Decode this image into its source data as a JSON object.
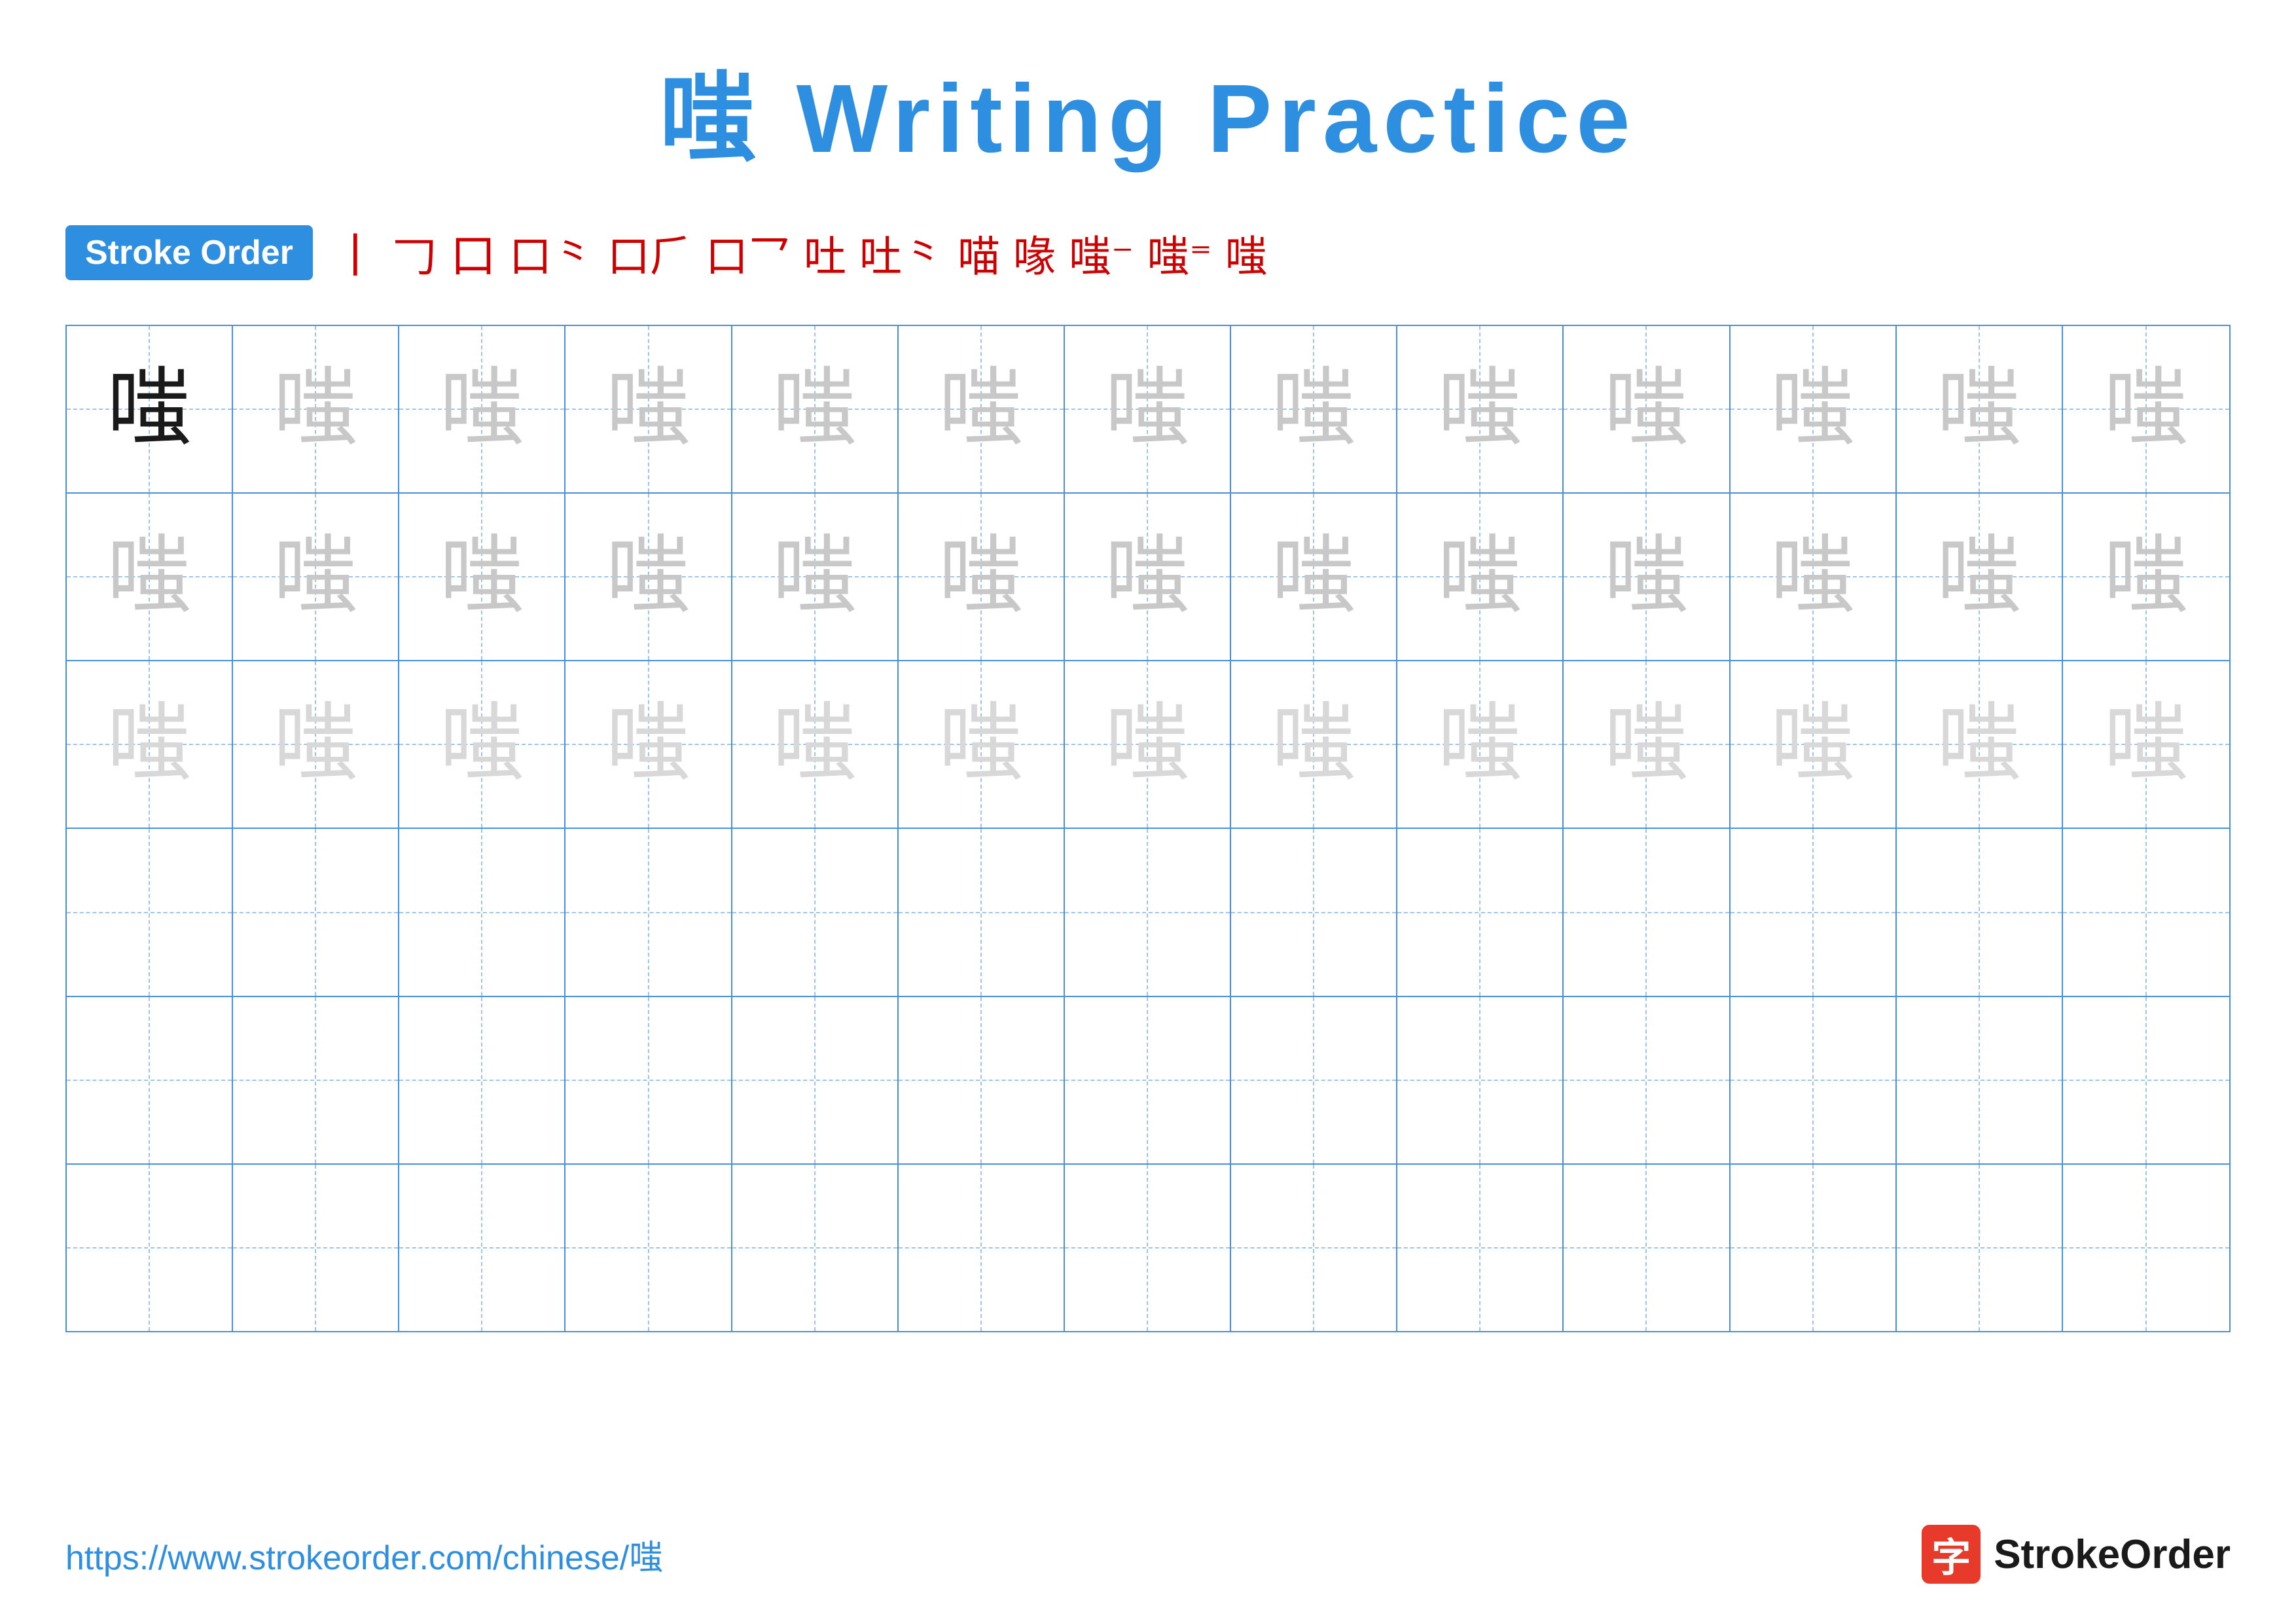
{
  "title": {
    "text": "嗤 Writing Practice",
    "character": "嗤"
  },
  "stroke_order": {
    "badge_label": "Stroke Order",
    "strokes": [
      "丨",
      "𠃌",
      "口",
      "口⺀",
      "口⺁",
      "口⺂",
      "口⺃",
      "口⺄",
      "口⺅",
      "嗤⁰",
      "嗤¹",
      "嗤²",
      "嗤"
    ]
  },
  "character": "嗤",
  "grid": {
    "rows": 6,
    "cols": 13,
    "row_types": [
      "dark_then_light",
      "gray",
      "lighter_gray",
      "empty",
      "empty",
      "empty"
    ]
  },
  "footer": {
    "url": "https://www.strokeorder.com/chinese/嗤",
    "logo_icon": "字",
    "logo_text": "StrokeOrder"
  },
  "colors": {
    "accent": "#2e8fe0",
    "red": "#cc0000",
    "dark_char": "#1a1a1a",
    "light_gray": "#c8c8c8",
    "lighter_gray": "#d8d8d8",
    "grid_border": "#4a90d9",
    "guide_dashed": "#a0c4e8"
  }
}
